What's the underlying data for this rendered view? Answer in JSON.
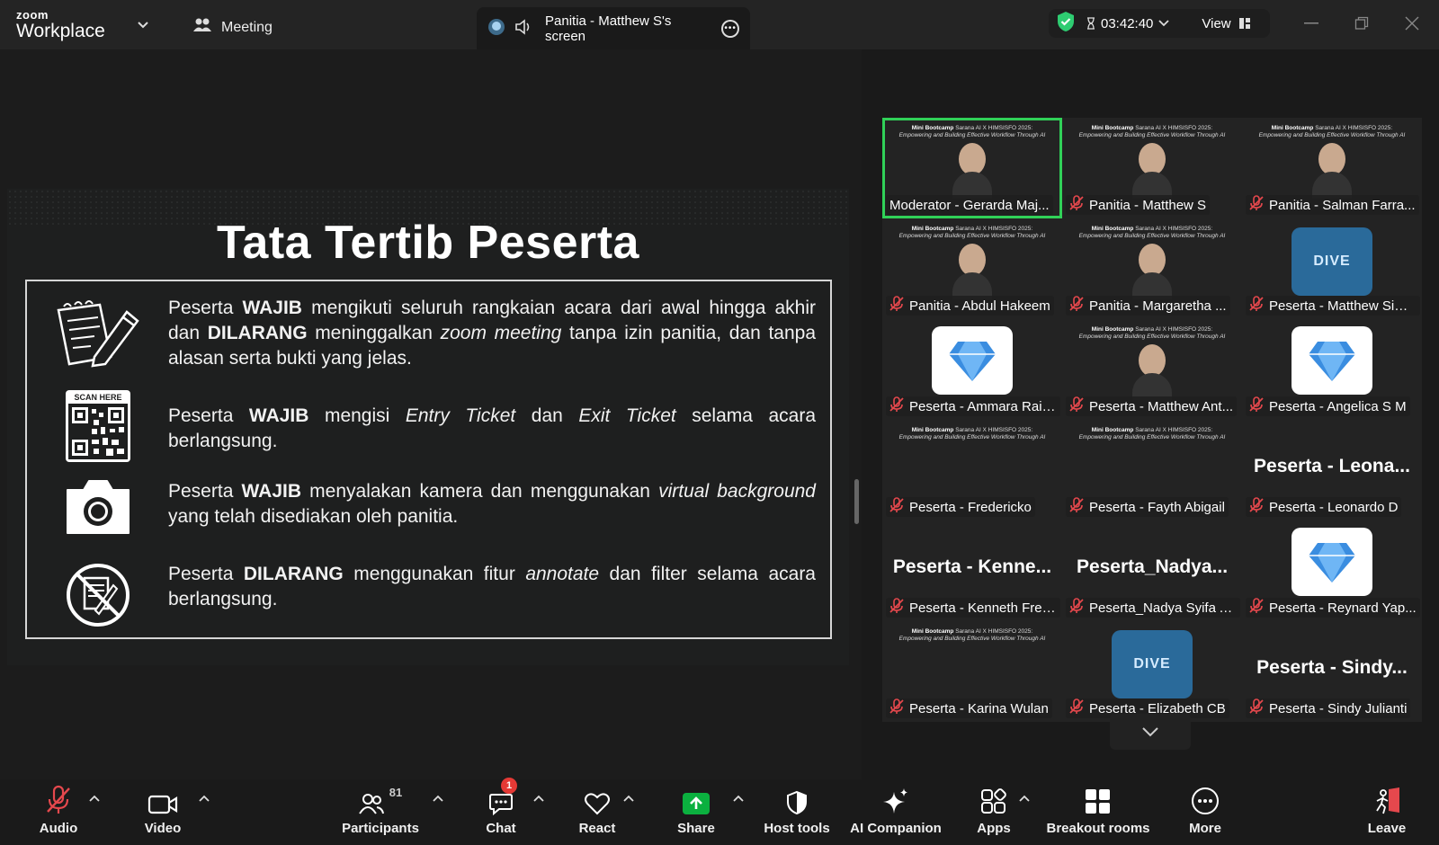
{
  "header": {
    "logo_small": "zoom",
    "logo_big": "Workplace",
    "meeting_label": "Meeting",
    "share_title": "Panitia - Matthew S's screen",
    "timer": "03:42:40",
    "view_label": "View"
  },
  "slide": {
    "title": "Tata Tertib Peserta",
    "qr_label": "SCAN HERE",
    "rules": [
      {
        "icon": "document-pencil-icon",
        "parts": [
          "Peserta ",
          "WAJIB",
          " mengikuti seluruh rangkaian acara dari awal hingga akhir dan ",
          "DILARANG",
          " meninggalkan ",
          "zoom meeting",
          " tanpa izin panitia, dan tanpa alasan serta bukti yang jelas."
        ]
      },
      {
        "icon": "qr-code-icon",
        "parts": [
          "Peserta ",
          "WAJIB",
          " mengisi ",
          "Entry Ticket",
          " dan ",
          "Exit Ticket",
          " selama acara berlangsung."
        ]
      },
      {
        "icon": "camera-icon",
        "parts": [
          "Peserta ",
          "WAJIB",
          " menyalakan kamera dan menggunakan ",
          "virtual background",
          " yang telah disediakan oleh panitia."
        ]
      },
      {
        "icon": "no-annotate-icon",
        "parts": [
          "Peserta ",
          "DILARANG",
          " menggunakan fitur ",
          "annotate",
          " dan filter selama acara berlangsung."
        ]
      }
    ]
  },
  "banner": {
    "line1_bold": "Mini Bootcamp",
    "line1_rest": " Sarana AI X HIMSISFO 2025:",
    "line2": "Empowering and Building Effective Workflow Through AI"
  },
  "gallery": {
    "tiles": [
      {
        "name": "Moderator - Gerarda Maj...",
        "kind": "video",
        "active": true,
        "muted": false
      },
      {
        "name": "Panitia - Matthew S",
        "kind": "video",
        "muted": true
      },
      {
        "name": "Panitia - Salman Farra...",
        "kind": "video",
        "muted": true
      },
      {
        "name": "Panitia - Abdul Hakeem",
        "kind": "video",
        "muted": true
      },
      {
        "name": "Panitia - Margaretha ...",
        "kind": "video",
        "muted": true
      },
      {
        "name": "Peserta - Matthew Sim...",
        "kind": "dive",
        "muted": true
      },
      {
        "name": "Peserta - Ammara Rais...",
        "kind": "logo",
        "muted": true
      },
      {
        "name": "Peserta - Matthew Ant...",
        "kind": "video",
        "muted": true
      },
      {
        "name": "Peserta - Angelica S M",
        "kind": "logo",
        "muted": true
      },
      {
        "name": "Peserta - Fredericko",
        "kind": "video-empty",
        "muted": true
      },
      {
        "name": "Peserta - Fayth Abigail",
        "kind": "video-empty",
        "muted": true
      },
      {
        "name": "Peserta - Leonardo D",
        "kind": "text",
        "big": "Peserta - Leona...",
        "muted": true
      },
      {
        "name": "Peserta - Kenneth Fred...",
        "kind": "text",
        "big": "Peserta - Kenne...",
        "muted": true
      },
      {
        "name": "Peserta_Nadya Syifa A...",
        "kind": "text",
        "big": "Peserta_Nadya...",
        "muted": true
      },
      {
        "name": "Peserta - Reynard Yap...",
        "kind": "logo",
        "muted": true
      },
      {
        "name": "Peserta - Karina Wulan",
        "kind": "video-empty",
        "muted": true
      },
      {
        "name": "Peserta - Elizabeth CB",
        "kind": "dive",
        "muted": true
      },
      {
        "name": "Peserta - Sindy Julianti",
        "kind": "text",
        "big": "Peserta - Sindy...",
        "muted": true
      }
    ],
    "dive_text": "DIVE"
  },
  "toolbar": {
    "audio": "Audio",
    "video": "Video",
    "participants": "Participants",
    "participants_count": "81",
    "chat": "Chat",
    "chat_badge": "1",
    "react": "React",
    "share": "Share",
    "host_tools": "Host tools",
    "ai_companion": "AI Companion",
    "apps": "Apps",
    "breakout": "Breakout rooms",
    "more": "More",
    "leave": "Leave"
  },
  "colors": {
    "active_speaker": "#30d158",
    "share_green": "#0bb03f",
    "badge_red": "#e53935",
    "muted_red": "#e5484d",
    "leave_red": "#e5484d"
  }
}
